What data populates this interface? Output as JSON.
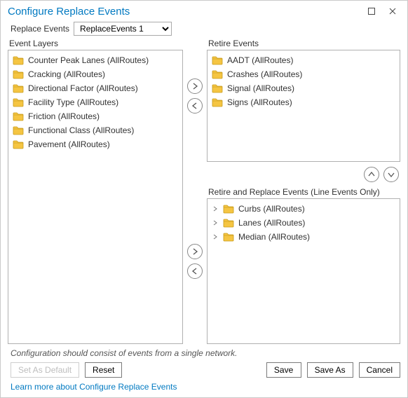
{
  "window": {
    "title": "Configure Replace Events"
  },
  "select_row": {
    "label": "Replace Events",
    "value": "ReplaceEvents 1"
  },
  "panels": {
    "event_layers_label": "Event Layers",
    "retire_label": "Retire Events",
    "retire_replace_label": "Retire and Replace Events (Line Events Only)"
  },
  "event_layers": [
    "Counter Peak Lanes (AllRoutes)",
    "Cracking (AllRoutes)",
    "Directional Factor (AllRoutes)",
    "Facility Type (AllRoutes)",
    "Friction (AllRoutes)",
    "Functional Class (AllRoutes)",
    "Pavement (AllRoutes)"
  ],
  "retire_events": [
    "AADT (AllRoutes)",
    "Crashes (AllRoutes)",
    "Signal (AllRoutes)",
    "Signs (AllRoutes)"
  ],
  "retire_replace_events": [
    "Curbs (AllRoutes)",
    "Lanes (AllRoutes)",
    "Median (AllRoutes)"
  ],
  "hint": "Configuration should consist of events from a single network.",
  "buttons": {
    "set_default": "Set As Default",
    "reset": "Reset",
    "save": "Save",
    "save_as": "Save As",
    "cancel": "Cancel"
  },
  "link_text": "Learn more about Configure Replace Events"
}
